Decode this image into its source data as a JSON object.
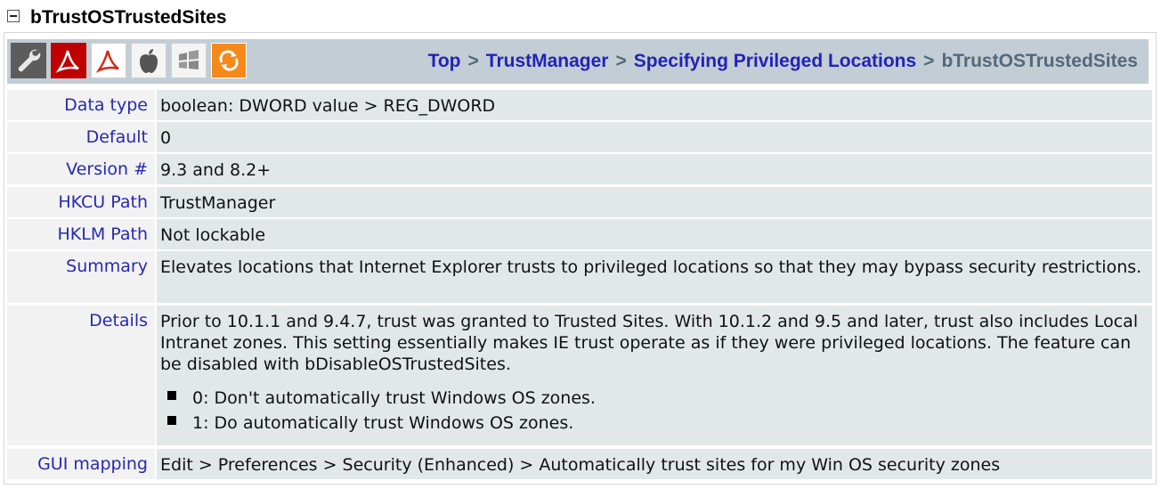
{
  "page": {
    "title": "bTrustOSTrustedSites"
  },
  "toolbar": {
    "icons": [
      {
        "name": "wrench-icon",
        "color": "#4a4a4a"
      },
      {
        "name": "acrobat-icon",
        "color": "#c40000"
      },
      {
        "name": "reader-icon",
        "color": "#d32a1a"
      },
      {
        "name": "apple-icon",
        "color": "#555555"
      },
      {
        "name": "windows-icon",
        "color": "#777777"
      },
      {
        "name": "sync-icon",
        "color": "#f08a1c"
      }
    ]
  },
  "breadcrumb": {
    "items": [
      "Top",
      "TrustManager",
      "Specifying Privileged Locations"
    ],
    "separator": ">",
    "current": "bTrustOSTrustedSites"
  },
  "properties": {
    "data_type": {
      "label": "Data type",
      "value": "boolean: DWORD value > REG_DWORD"
    },
    "default": {
      "label": "Default",
      "value": "0"
    },
    "version": {
      "label": "Version #",
      "value": "9.3 and 8.2+"
    },
    "hkcu": {
      "label": "HKCU Path",
      "value": "TrustManager"
    },
    "hklm": {
      "label": "HKLM Path",
      "value": "Not lockable"
    },
    "summary": {
      "label": "Summary",
      "value": "Elevates locations that Internet Explorer trusts to privileged locations so that they may bypass security restrictions."
    },
    "details": {
      "label": "Details",
      "text": "Prior to 10.1.1 and 9.4.7, trust was granted to Trusted Sites. With 10.1.2 and 9.5 and later, trust also includes Local Intranet zones. This setting essentially makes IE trust operate as if they were privileged locations. The feature can be disabled with bDisableOSTrustedSites.",
      "options": [
        "0: Don't automatically trust Windows OS zones.",
        "1: Do automatically trust Windows OS zones."
      ]
    },
    "gui_mapping": {
      "label": "GUI mapping",
      "value": "Edit > Preferences > Security (Enhanced) > Automatically trust sites for my Win OS security zones"
    }
  },
  "colors": {
    "header_bar": "#c3cdd6",
    "link": "#2323b8",
    "label_bg": "#f2f2f2",
    "value_bg": "#e2e8e8"
  }
}
